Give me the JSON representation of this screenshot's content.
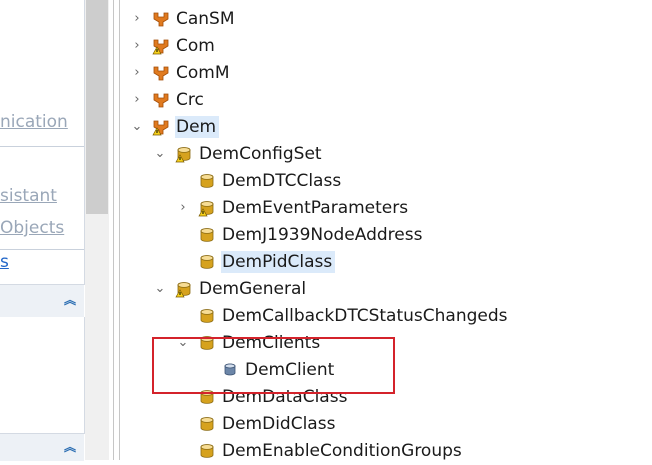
{
  "left_panel": {
    "links": [
      "nication",
      "sistant",
      "Objects",
      "s"
    ]
  },
  "tree": {
    "rows": [
      {
        "label": "CanSM",
        "icon": "module-icon",
        "toggle": "›",
        "warn": false
      },
      {
        "label": "Com",
        "icon": "module-icon",
        "toggle": "›",
        "warn": true
      },
      {
        "label": "ComM",
        "icon": "module-icon",
        "toggle": "›",
        "warn": false
      },
      {
        "label": "Crc",
        "icon": "module-icon",
        "toggle": "›",
        "warn": false
      },
      {
        "label": "Dem",
        "icon": "module-icon",
        "toggle": "⌄",
        "warn": true,
        "selected": true
      },
      {
        "label": "DemConfigSet",
        "icon": "container-icon",
        "toggle": "⌄",
        "warn": true
      },
      {
        "label": "DemDTCClass",
        "icon": "container-icon",
        "toggle": "",
        "warn": false
      },
      {
        "label": "DemEventParameters",
        "icon": "container-icon",
        "toggle": "›",
        "warn": true
      },
      {
        "label": "DemJ1939NodeAddress",
        "icon": "container-icon",
        "toggle": "",
        "warn": false
      },
      {
        "label": "DemPidClass",
        "icon": "container-icon",
        "toggle": "",
        "warn": false,
        "selected": true
      },
      {
        "label": "DemGeneral",
        "icon": "container-icon",
        "toggle": "⌄",
        "warn": true
      },
      {
        "label": "DemCallbackDTCStatusChangeds",
        "icon": "container-icon",
        "toggle": "",
        "warn": false
      },
      {
        "label": "DemClients",
        "icon": "container-icon",
        "toggle": "⌄",
        "warn": false
      },
      {
        "label": "DemClient",
        "icon": "instance-icon",
        "toggle": "",
        "warn": false
      },
      {
        "label": "DemDataClass",
        "icon": "container-icon",
        "toggle": "",
        "warn": false
      },
      {
        "label": "DemDidClass",
        "icon": "container-icon",
        "toggle": "",
        "warn": false
      },
      {
        "label": "DemEnableConditionGroups",
        "icon": "container-icon",
        "toggle": "",
        "warn": false
      }
    ]
  },
  "colors": {
    "highlight": "#d4232b",
    "selection": "#dbeafa",
    "module_orange": "#e07a1f",
    "container_gold": "#d6a21e",
    "instance_blue": "#6c86a8"
  }
}
